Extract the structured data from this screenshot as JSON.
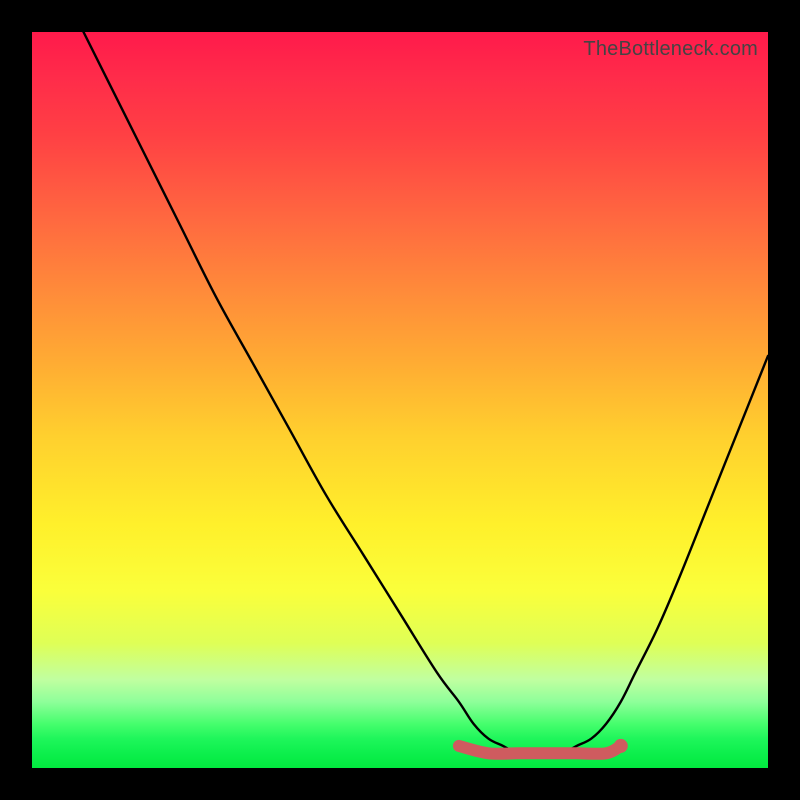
{
  "watermark": "TheBottleneck.com",
  "chart_data": {
    "type": "line",
    "title": "",
    "xlabel": "",
    "ylabel": "",
    "xlim": [
      0,
      100
    ],
    "ylim": [
      0,
      100
    ],
    "grid": false,
    "legend": false,
    "series": [
      {
        "name": "bottleneck-curve",
        "color": "#000000",
        "x": [
          7,
          10,
          15,
          20,
          25,
          30,
          35,
          40,
          45,
          50,
          55,
          58,
          60,
          62,
          64,
          66,
          68,
          70,
          72,
          74,
          76,
          78,
          80,
          82,
          85,
          88,
          92,
          96,
          100
        ],
        "y": [
          100,
          94,
          84,
          74,
          64,
          55,
          46,
          37,
          29,
          21,
          13,
          9,
          6,
          4,
          3,
          2,
          2,
          2,
          2,
          3,
          4,
          6,
          9,
          13,
          19,
          26,
          36,
          46,
          56
        ]
      },
      {
        "name": "highlight-band",
        "color": "#cf5b5f",
        "x": [
          58,
          62,
          66,
          70,
          74,
          78,
          80
        ],
        "y": [
          3,
          2,
          2,
          2,
          2,
          2,
          3
        ]
      }
    ],
    "annotations": []
  }
}
